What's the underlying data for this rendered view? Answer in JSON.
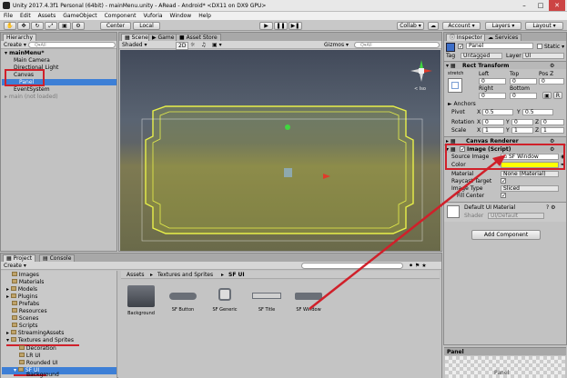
{
  "window": {
    "title": "Unity 2017.4.3f1 Personal (64bit) - mainMenu.unity - ARead - Android* <DX11 on DX9 GPU>"
  },
  "menu": [
    "File",
    "Edit",
    "Assets",
    "GameObject",
    "Component",
    "Vuforia",
    "Window",
    "Help"
  ],
  "toolbar": {
    "center": "Center",
    "local": "Local",
    "collab": "Collab ▾",
    "account": "Account",
    "layers": "Layers",
    "layout": "Layout"
  },
  "hierarchy": {
    "tab": "Hierarchy",
    "create": "Create ▾",
    "search": "Q▾All",
    "items": [
      "mainMenu*",
      "Main Camera",
      "Directional Light",
      "Canvas",
      "Panel",
      "EventSystem",
      "main (not loaded)"
    ]
  },
  "scene": {
    "tabs": [
      "Scene",
      "Game",
      "Asset Store"
    ],
    "shading": "Shaded",
    "mode2d": "2D",
    "gizmos": "Gizmos ▾",
    "search": "Q▾All",
    "persp": "< Iso"
  },
  "inspector": {
    "tabs": [
      "Inspector",
      "Services"
    ],
    "object_name": "Panel",
    "static": "Static ▾",
    "tag_label": "Tag",
    "tag_value": "Untagged",
    "layer_label": "Layer",
    "layer_value": "UI",
    "rect_transform": "Rect Transform",
    "stretch": "stretch",
    "left_label": "Left",
    "top_label": "Top",
    "posz_label": "Pos Z",
    "left": "0",
    "top": "0",
    "posz": "0",
    "right_label": "Right",
    "bottom_label": "Bottom",
    "right": "0",
    "bottom": "0",
    "anchors": "► Anchors",
    "pivot_label": "Pivot",
    "pivot_x": "0.5",
    "pivot_y": "0.5",
    "rotation_label": "Rotation",
    "scale_label": "Scale",
    "rx": "0",
    "ry": "0",
    "rz": "0",
    "sx": "1",
    "sy": "1",
    "sz": "1",
    "canvas_renderer": "Canvas Renderer",
    "image_script": "Image (Script)",
    "source_image_label": "Source Image",
    "source_image": "SF Window",
    "color_label": "Color",
    "material_label": "Material",
    "material_value": "None (Material)",
    "raycast_label": "Raycast Target",
    "image_type_label": "Image Type",
    "image_type_value": "Sliced",
    "fill_center_label": "Fill Center",
    "default_material": "Default UI Material",
    "shader_label": "Shader",
    "shader_value": "UI/Default",
    "add_component": "Add Component",
    "preview_label": "Panel",
    "preview_text": "Panel"
  },
  "project": {
    "tabs": [
      "Project",
      "Console"
    ],
    "create": "Create ▾",
    "breadcrumb": [
      "Assets",
      "Textures and Sprites",
      "SF UI"
    ],
    "tree": [
      "Images",
      "Materials",
      "Models",
      "Plugins",
      "Prefabs",
      "Resources",
      "Scenes",
      "Scripts",
      "StreamingAssets",
      "Textures and Sprites",
      "Decoration",
      "LR UI",
      "Rounded UI",
      "SF UI",
      "Background"
    ],
    "assets": [
      "Background",
      "SF Button",
      "SF Generic",
      "SF Title",
      "SF Window"
    ]
  },
  "colors": {
    "accent_red": "#d0202a",
    "selection": "#3d7fd6",
    "color_swatch": "#ffff00"
  }
}
